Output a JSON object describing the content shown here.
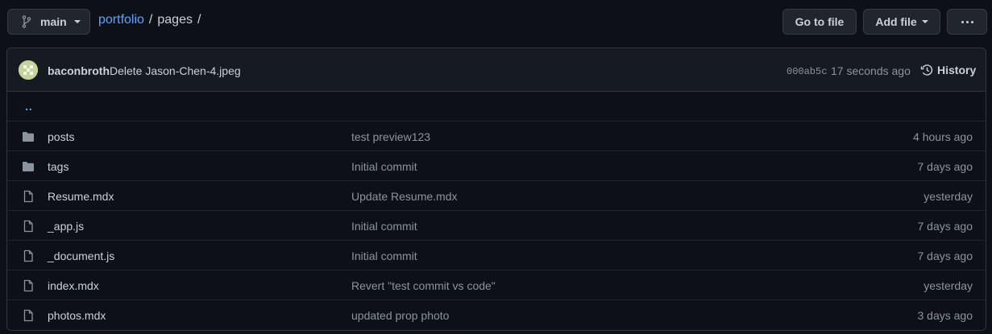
{
  "branch": {
    "name": "main",
    "icon": "git-branch-icon"
  },
  "breadcrumb": {
    "repo": "portfolio",
    "sep1": "/",
    "dir": "pages",
    "sep2": "/"
  },
  "actions": {
    "go_to_file": "Go to file",
    "add_file": "Add file"
  },
  "commit": {
    "author": "baconbroth",
    "message": "Delete Jason-Chen-4.jpeg",
    "sha": "000ab5c",
    "time": "17 seconds ago",
    "history_label": "History"
  },
  "parent_link": "..",
  "files": [
    {
      "type": "dir",
      "name": "posts",
      "message": "test preview123",
      "age": "4 hours ago"
    },
    {
      "type": "dir",
      "name": "tags",
      "message": "Initial commit",
      "age": "7 days ago"
    },
    {
      "type": "file",
      "name": "Resume.mdx",
      "message": "Update Resume.mdx",
      "age": "yesterday"
    },
    {
      "type": "file",
      "name": "_app.js",
      "message": "Initial commit",
      "age": "7 days ago"
    },
    {
      "type": "file",
      "name": "_document.js",
      "message": "Initial commit",
      "age": "7 days ago"
    },
    {
      "type": "file",
      "name": "index.mdx",
      "message": "Revert \"test commit vs code\"",
      "age": "yesterday"
    },
    {
      "type": "file",
      "name": "photos.mdx",
      "message": "updated prop photo",
      "age": "3 days ago"
    }
  ],
  "colors": {
    "background": "#0d1117",
    "link": "#58a6ff",
    "muted": "#8b949e",
    "border": "#30363d"
  }
}
